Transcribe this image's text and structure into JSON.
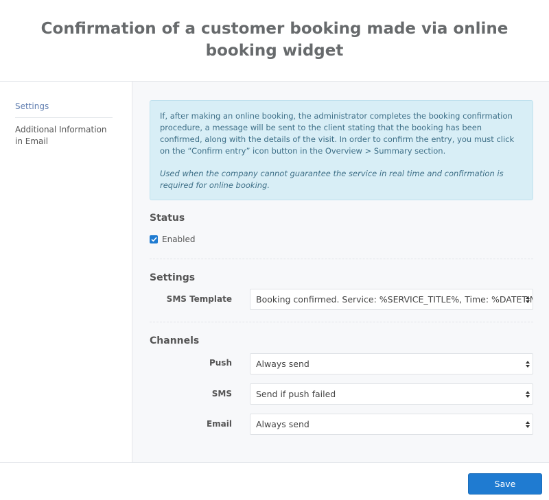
{
  "header": {
    "title": "Confirmation of a customer booking made via online booking widget"
  },
  "sidebar": {
    "items": [
      {
        "label": "Settings",
        "active": true
      },
      {
        "label": "Additional Information in Email",
        "active": false
      }
    ]
  },
  "info": {
    "text_before_link1": "If, after making an online booking, the administrator completes the booking confirmation procedure, a message will be sent to the client stating that the booking has been confirmed, along with the details of the visit. In order to confirm the entry, you must click on the “Confirm entry” icon button in the ",
    "link1": "Overview",
    "separator": " > ",
    "link2": "Summary",
    "text_after_link2": " section.",
    "note": "Used when the company cannot guarantee the service in real time and confirmation is required for online booking."
  },
  "status": {
    "title": "Status",
    "enabled_label": "Enabled",
    "enabled": true
  },
  "settings": {
    "title": "Settings",
    "sms_template_label": "SMS Template",
    "sms_template_value": "Booking confirmed. Service: %SERVICE_TITLE%, Time: %DATETIME%"
  },
  "channels": {
    "title": "Channels",
    "push_label": "Push",
    "push_value": "Always send",
    "sms_label": "SMS",
    "sms_value": "Send if push failed",
    "email_label": "Email",
    "email_value": "Always send"
  },
  "footer": {
    "save_label": "Save"
  },
  "colors": {
    "accent": "#1f7bd1",
    "info_bg": "#d8eef6",
    "info_text": "#3e6f87",
    "title": "#676a6c",
    "sidebar_active": "#5f7db0"
  },
  "icons": {
    "checkbox": "check-icon",
    "select": "updown-arrows-icon"
  }
}
